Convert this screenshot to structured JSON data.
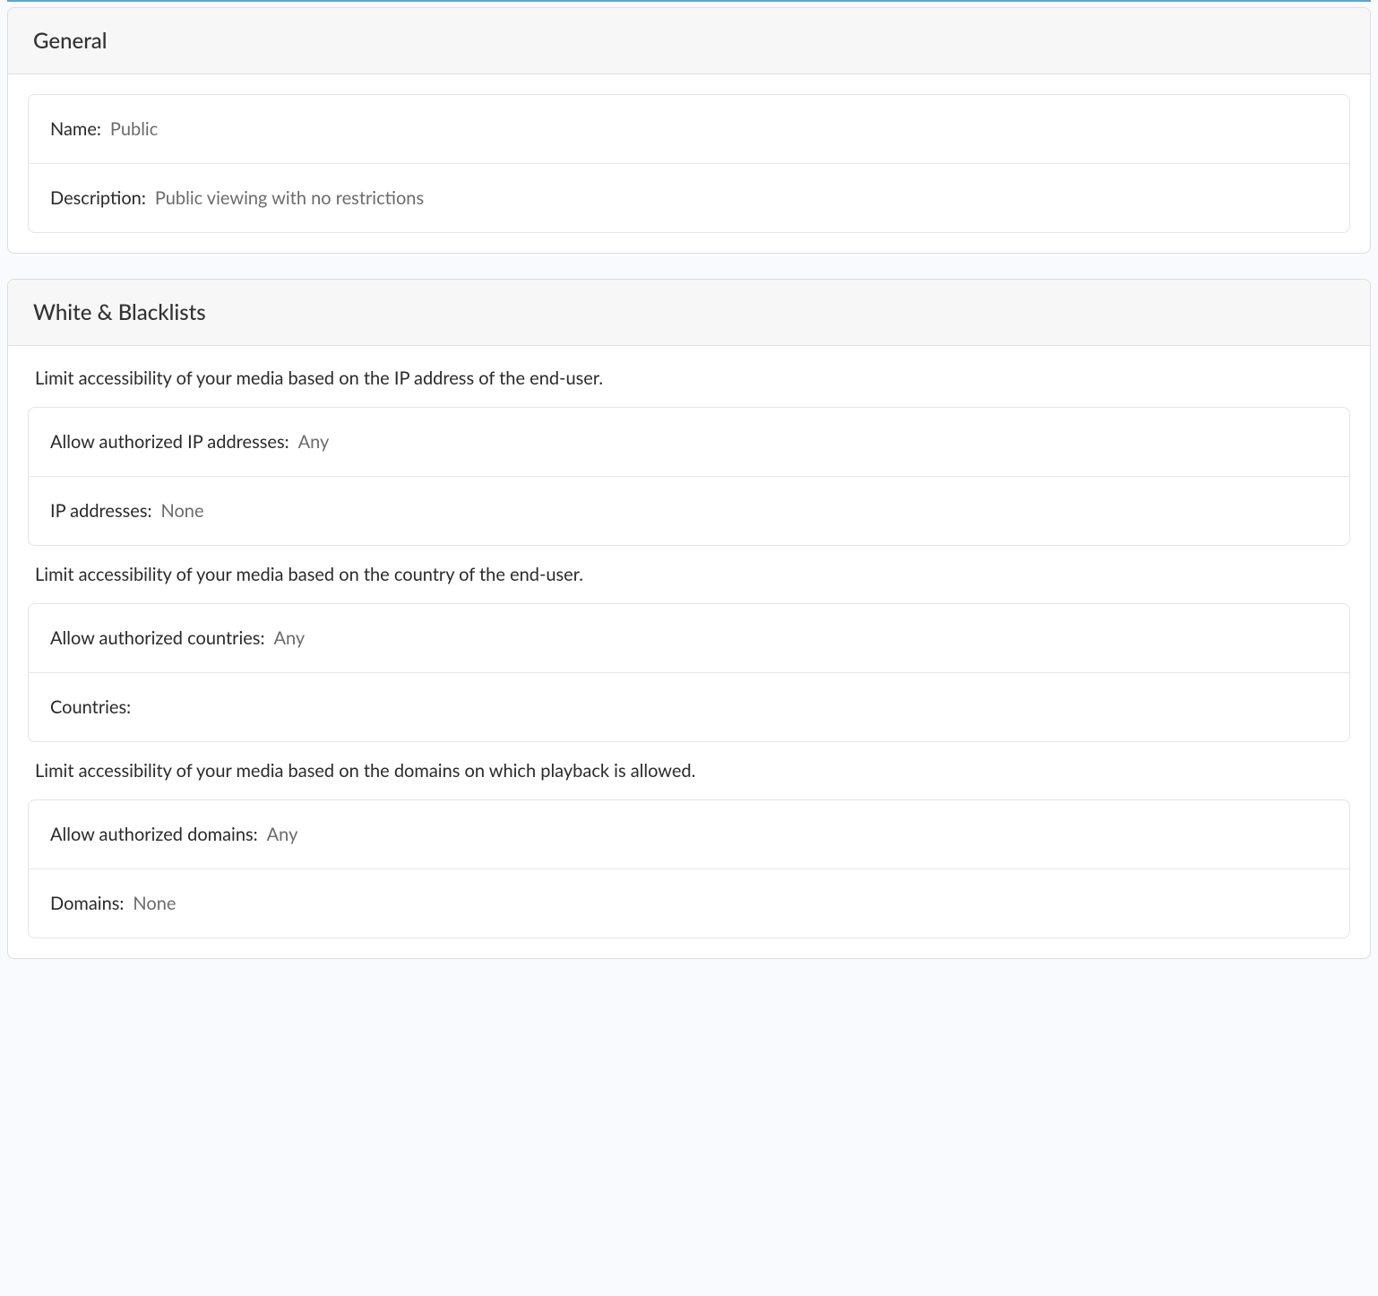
{
  "general": {
    "title": "General",
    "name_label": "Name:",
    "name_value": "Public",
    "description_label": "Description:",
    "description_value": "Public viewing with no restrictions"
  },
  "wb": {
    "title": "White & Blacklists",
    "ip_desc": "Limit accessibility of your media based on the IP address of the end-user.",
    "allow_ip_label": "Allow authorized IP addresses:",
    "allow_ip_value": "Any",
    "ip_label": "IP addresses:",
    "ip_value": "None",
    "country_desc": "Limit accessibility of your media based on the country of the end-user.",
    "allow_country_label": "Allow authorized countries:",
    "allow_country_value": "Any",
    "countries_label": "Countries:",
    "countries_value": "",
    "domain_desc": "Limit accessibility of your media based on the domains on which playback is allowed.",
    "allow_domain_label": "Allow authorized domains:",
    "allow_domain_value": "Any",
    "domains_label": "Domains:",
    "domains_value": "None"
  }
}
